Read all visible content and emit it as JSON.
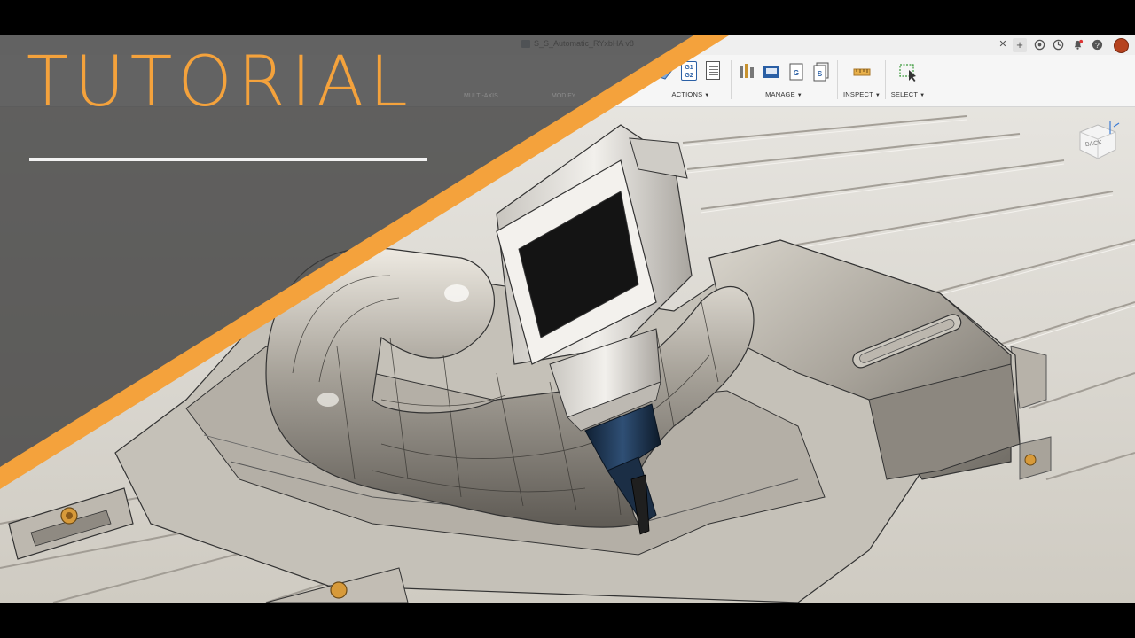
{
  "document": {
    "tab_title": "S_S_Automatic_RYxbHA v8"
  },
  "toolbar": {
    "groups": [
      {
        "label": "ACTIONS"
      },
      {
        "label": "MANAGE"
      },
      {
        "label": "INSPECT"
      },
      {
        "label": "SELECT"
      }
    ],
    "icons": {
      "g1g2": "G1\nG2",
      "g1": "G1",
      "g2": "G2"
    }
  },
  "overlay_toolbar": {
    "labels": [
      "MULTI-AXIS",
      "MODIFY"
    ]
  },
  "viewcube": {
    "label": "BACK"
  },
  "tutorial": {
    "title": "TUTORIAL"
  },
  "colors": {
    "accent": "#f4a23c",
    "overlay_dark": "#3a3a3a",
    "spindle_blue": "#1f3550",
    "avatar": "#b6431f"
  }
}
